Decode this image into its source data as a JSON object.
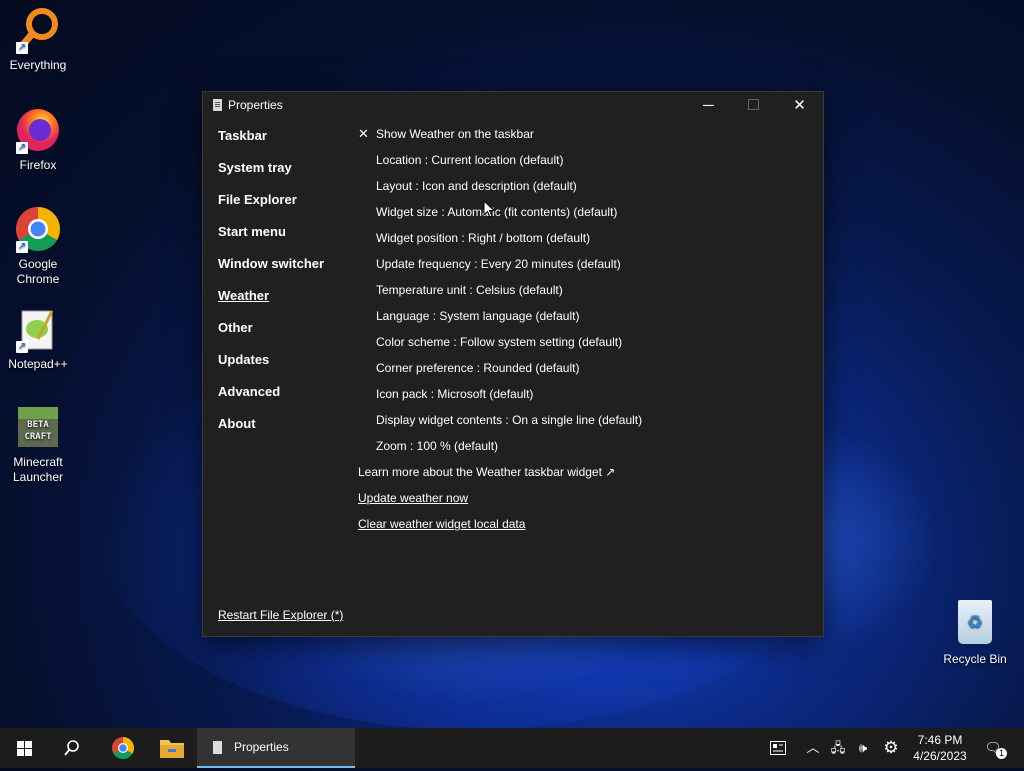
{
  "desktop": {
    "icons": [
      {
        "label": "Everything"
      },
      {
        "label": "Firefox"
      },
      {
        "label": "Google Chrome"
      },
      {
        "label": "Notepad++"
      },
      {
        "label": "Minecraft Launcher"
      },
      {
        "label": "Recycle Bin"
      }
    ],
    "minecraft_logo_text": "BETA CRAFT"
  },
  "window": {
    "title": "Properties",
    "minimize_glyph": "─",
    "maximize_glyph": "☐",
    "close_glyph": "✕",
    "nav": [
      {
        "label": "Taskbar"
      },
      {
        "label": "System tray"
      },
      {
        "label": "File Explorer"
      },
      {
        "label": "Start menu"
      },
      {
        "label": "Window switcher"
      },
      {
        "label": "Weather",
        "active": true
      },
      {
        "label": "Other"
      },
      {
        "label": "Updates"
      },
      {
        "label": "Advanced"
      },
      {
        "label": "About"
      }
    ],
    "settings": {
      "show_weather_check": "✕",
      "show_weather": "Show Weather on the taskbar",
      "location": "Location : Current location (default)",
      "layout": "Layout : Icon and description (default)",
      "widget_size": "Widget size : Automatic (fit contents) (default)",
      "widget_position": "Widget position : Right / bottom (default)",
      "update_frequency": "Update frequency : Every 20 minutes (default)",
      "temperature_unit": "Temperature unit : Celsius (default)",
      "language": "Language : System language (default)",
      "color_scheme": "Color scheme : Follow system setting (default)",
      "corner_preference": "Corner preference : Rounded (default)",
      "icon_pack": "Icon pack : Microsoft (default)",
      "display_widget_contents": "Display widget contents : On a single line (default)",
      "zoom": "Zoom : 100 % (default)"
    },
    "links": {
      "learn_more": "Learn more about the Weather taskbar widget ↗",
      "update_now": "Update weather now",
      "clear_data": "Clear weather widget local data"
    },
    "restart_explorer": "Restart File Explorer (*)"
  },
  "taskbar": {
    "search_glyph": "⚲",
    "active_window_label": "Properties",
    "tray_chevron": "︿",
    "network_glyph": "🖧",
    "volume_glyph": "🕪",
    "settings_glyph": "⚙",
    "notification_glyph": "🗨",
    "notification_count": "1",
    "time": "7:46 PM",
    "date": "4/26/2023"
  },
  "colors": {
    "window_bg": "#202020",
    "taskbar_bg": "#1c1c1c",
    "accent": "#76b9ed"
  }
}
